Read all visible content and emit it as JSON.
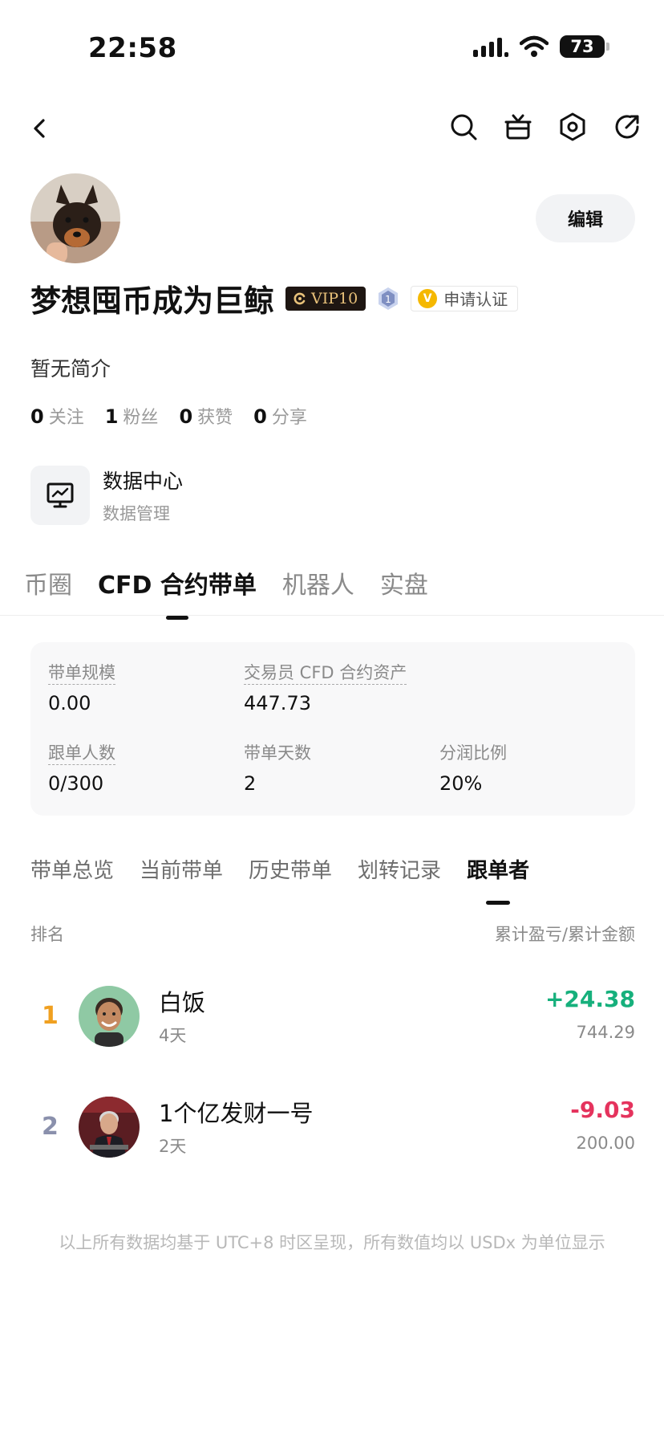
{
  "status_bar": {
    "time": "22:58",
    "battery": "73"
  },
  "profile": {
    "username": "梦想囤币成为巨鲸",
    "vip_label": "VIP10",
    "level": "1",
    "verify_label": "申请认证",
    "edit_label": "编辑",
    "bio": "暂无简介",
    "stats": [
      {
        "value": "0",
        "label": "关注"
      },
      {
        "value": "1",
        "label": "粉丝"
      },
      {
        "value": "0",
        "label": "获赞"
      },
      {
        "value": "0",
        "label": "分享"
      }
    ]
  },
  "data_center": {
    "title": "数据中心",
    "subtitle": "数据管理"
  },
  "main_tabs": [
    {
      "label": "币圈",
      "active": false
    },
    {
      "label": "CFD 合约带单",
      "active": true
    },
    {
      "label": "机器人",
      "active": false
    },
    {
      "label": "实盘",
      "active": false
    }
  ],
  "summary": {
    "scale": {
      "label": "带单规模",
      "value": "0.00"
    },
    "assets": {
      "label": "交易员 CFD 合约资产",
      "value": "447.73"
    },
    "followers": {
      "label": "跟单人数",
      "value": "0/300"
    },
    "days": {
      "label": "带单天数",
      "value": "2"
    },
    "profit_share": {
      "label": "分润比例",
      "value": "20%"
    }
  },
  "sub_tabs": [
    {
      "label": "带单总览",
      "active": false
    },
    {
      "label": "当前带单",
      "active": false
    },
    {
      "label": "历史带单",
      "active": false
    },
    {
      "label": "划转记录",
      "active": false
    },
    {
      "label": "跟单者",
      "active": true
    }
  ],
  "list_header": {
    "left": "排名",
    "right": "累计盈亏/累计金额"
  },
  "followers": [
    {
      "rank": "1",
      "name": "白饭",
      "days": "4天",
      "pnl": "+24.38",
      "amount": "744.29"
    },
    {
      "rank": "2",
      "name": "1个亿发财一号",
      "days": "2天",
      "pnl": "-9.03",
      "amount": "200.00"
    }
  ],
  "footnote": "以上所有数据均基于 UTC+8 时区呈现，所有数值均以 USDx 为单位显示",
  "colors": {
    "positive": "#16b07c",
    "negative": "#e5335d",
    "rank1": "#f0a020",
    "rank2": "#8a90ac",
    "vip_gold": "#e9c27a"
  }
}
